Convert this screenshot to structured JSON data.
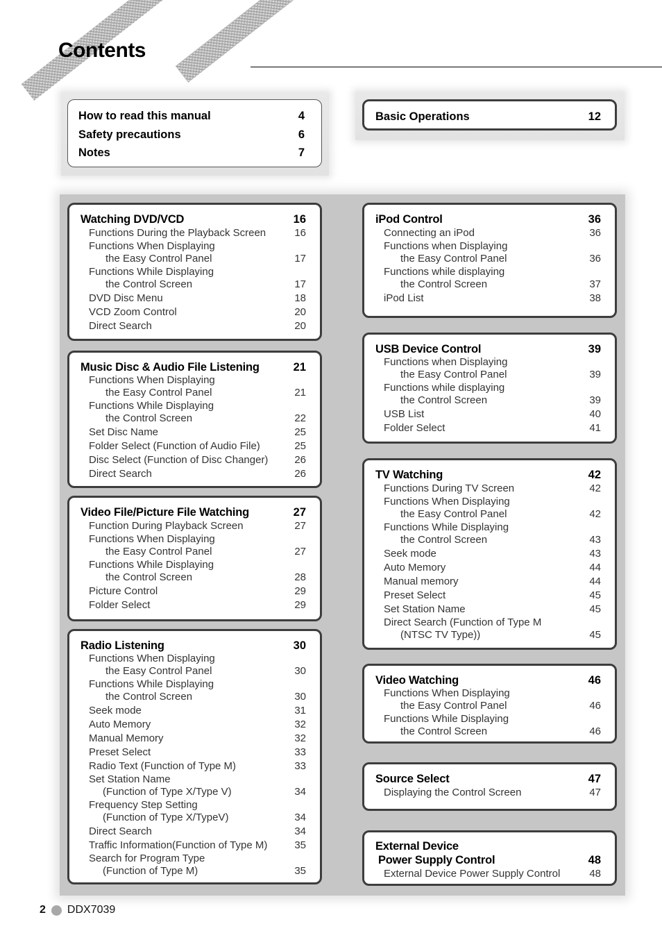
{
  "page_title": "Contents",
  "top_left_box": [
    {
      "label": "How to read this manual",
      "page": "4"
    },
    {
      "label": "Safety precautions",
      "page": "6"
    },
    {
      "label": "Notes",
      "page": "7"
    }
  ],
  "top_right_box": [
    {
      "label": "Basic Operations",
      "page": "12"
    }
  ],
  "sections": {
    "watching_dvd_vcd": {
      "title": "Watching DVD/VCD",
      "page": "16",
      "entries": [
        {
          "label": "Functions During the Playback Screen",
          "page": "16"
        },
        {
          "label": "Functions When Displaying",
          "page": ""
        },
        {
          "label": "the Easy Control Panel",
          "page": "17"
        },
        {
          "label": "Functions While Displaying",
          "page": ""
        },
        {
          "label": "the Control Screen",
          "page": "17"
        },
        {
          "label": "DVD Disc Menu",
          "page": "18"
        },
        {
          "label": "VCD Zoom Control",
          "page": "20"
        },
        {
          "label": "Direct Search",
          "page": "20"
        }
      ]
    },
    "music_disc": {
      "title": "Music Disc & Audio File Listening",
      "page": "21",
      "entries": [
        {
          "label": "Functions When Displaying",
          "page": ""
        },
        {
          "label": "the Easy Control Panel",
          "page": "21"
        },
        {
          "label": "Functions While Displaying",
          "page": ""
        },
        {
          "label": "the Control Screen",
          "page": "22"
        },
        {
          "label": "Set Disc Name",
          "page": "25"
        },
        {
          "label": "Folder Select (Function of Audio File)",
          "page": "25"
        },
        {
          "label": "Disc Select (Function of Disc Changer)",
          "page": "26"
        },
        {
          "label": "Direct Search",
          "page": "26"
        }
      ]
    },
    "video_file": {
      "title": "Video File/Picture File Watching",
      "page": "27",
      "entries": [
        {
          "label": "Function During Playback Screen",
          "page": "27"
        },
        {
          "label": "Functions When Displaying",
          "page": ""
        },
        {
          "label": "the Easy Control Panel",
          "page": "27"
        },
        {
          "label": "Functions While Displaying",
          "page": ""
        },
        {
          "label": "the Control Screen",
          "page": "28"
        },
        {
          "label": "Picture Control",
          "page": "29"
        },
        {
          "label": "Folder Select",
          "page": "29"
        }
      ]
    },
    "radio": {
      "title": "Radio Listening",
      "page": "30",
      "entries": [
        {
          "label": "Functions When Displaying",
          "page": ""
        },
        {
          "label": "the Easy Control Panel",
          "page": "30"
        },
        {
          "label": "Functions While Displaying",
          "page": ""
        },
        {
          "label": "the Control Screen",
          "page": "30"
        },
        {
          "label": "Seek mode",
          "page": "31"
        },
        {
          "label": "Auto Memory",
          "page": "32"
        },
        {
          "label": "Manual Memory",
          "page": "32"
        },
        {
          "label": "Preset Select",
          "page": "33"
        },
        {
          "label": "Radio Text (Function of Type M)",
          "page": "33"
        },
        {
          "label": "Set Station Name",
          "page": ""
        },
        {
          "label": "(Function of Type X/Type V)",
          "page": "34"
        },
        {
          "label": "Frequency Step Setting",
          "page": ""
        },
        {
          "label": "(Function of Type X/TypeV)",
          "page": "34"
        },
        {
          "label": "Direct Search",
          "page": "34"
        },
        {
          "label": "Traffic Information(Function of Type M)",
          "page": "35"
        },
        {
          "label": "Search for Program Type",
          "page": ""
        },
        {
          "label": "(Function of Type M)",
          "page": "35"
        }
      ]
    },
    "ipod": {
      "title": "iPod Control",
      "page": "36",
      "entries": [
        {
          "label": "Connecting an iPod",
          "page": "36"
        },
        {
          "label": "Functions when Displaying",
          "page": ""
        },
        {
          "label": "the Easy Control Panel",
          "page": "36"
        },
        {
          "label": "Functions while displaying",
          "page": ""
        },
        {
          "label": "the Control Screen",
          "page": "37"
        },
        {
          "label": "iPod List",
          "page": "38"
        }
      ]
    },
    "usb": {
      "title": "USB Device Control",
      "page": "39",
      "entries": [
        {
          "label": "Functions when Displaying",
          "page": ""
        },
        {
          "label": "the Easy Control Panel",
          "page": "39"
        },
        {
          "label": "Functions while displaying",
          "page": ""
        },
        {
          "label": "the Control Screen",
          "page": "39"
        },
        {
          "label": "USB List",
          "page": "40"
        },
        {
          "label": "Folder Select",
          "page": "41"
        }
      ]
    },
    "tv": {
      "title": "TV Watching",
      "page": "42",
      "entries": [
        {
          "label": "Functions During TV Screen",
          "page": "42"
        },
        {
          "label": "Functions When Displaying",
          "page": ""
        },
        {
          "label": "the Easy Control Panel",
          "page": "42"
        },
        {
          "label": "Functions While Displaying",
          "page": ""
        },
        {
          "label": "the Control Screen",
          "page": "43"
        },
        {
          "label": "Seek mode",
          "page": "43"
        },
        {
          "label": "Auto Memory",
          "page": "44"
        },
        {
          "label": "Manual memory",
          "page": "44"
        },
        {
          "label": "Preset Select",
          "page": "45"
        },
        {
          "label": "Set Station Name",
          "page": "45"
        },
        {
          "label": "Direct Search (Function of Type M",
          "page": ""
        },
        {
          "label": "(NTSC TV Type))",
          "page": "45"
        }
      ]
    },
    "video_watching": {
      "title": "Video Watching",
      "page": "46",
      "entries": [
        {
          "label": "Functions When Displaying",
          "page": ""
        },
        {
          "label": "the Easy Control Panel",
          "page": "46"
        },
        {
          "label": "Functions While Displaying",
          "page": ""
        },
        {
          "label": "the Control Screen",
          "page": "46"
        }
      ]
    },
    "source_select": {
      "title": "Source Select",
      "page": "47",
      "entries": [
        {
          "label": "Displaying the Control Screen",
          "page": "47"
        }
      ]
    },
    "external_device": {
      "title_line1": "External Device",
      "title": "Power Supply Control",
      "page": "48",
      "entries": [
        {
          "label": "External Device Power Supply Control",
          "page": "48"
        }
      ]
    }
  },
  "footer": {
    "page_number": "2",
    "model": "DDX7039"
  }
}
